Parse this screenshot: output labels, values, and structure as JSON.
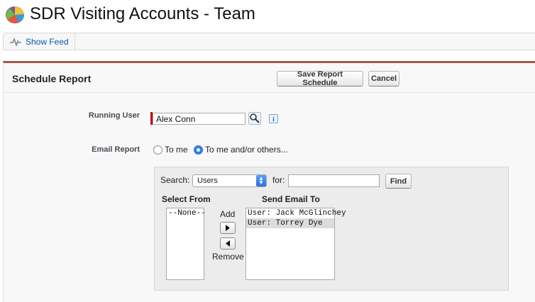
{
  "header": {
    "title": "SDR Visiting Accounts - Team",
    "logo_icon": "report-pie-logo-icon"
  },
  "feed": {
    "show_feed_label": "Show Feed",
    "icon": "feed-pulse-icon"
  },
  "schedule": {
    "section_title": "Schedule Report",
    "save_label": "Save Report Schedule",
    "cancel_label": "Cancel",
    "accent_color": "#a55a46",
    "running_user": {
      "label": "Running User",
      "value": "Alex Conn",
      "lookup_icon": "lookup-magnifier-icon",
      "info_icon": "info-icon",
      "info_text": "i"
    },
    "email_report": {
      "label": "Email Report",
      "options": [
        {
          "label": "To me",
          "checked": false
        },
        {
          "label": "To me and/or others...",
          "checked": true
        }
      ]
    },
    "recipients": {
      "search_label": "Search:",
      "search_type": "Users",
      "for_label": "for:",
      "for_value": "",
      "find_label": "Find",
      "select_from_header": "Select From",
      "send_email_header": "Send Email To",
      "select_from_items": [
        "--None--"
      ],
      "send_email_items": [
        {
          "text": "User: Jack McGlinchey",
          "selected": false
        },
        {
          "text": "User: Torrey Dye",
          "selected": true
        }
      ],
      "add_label": "Add",
      "remove_label": "Remove"
    }
  }
}
